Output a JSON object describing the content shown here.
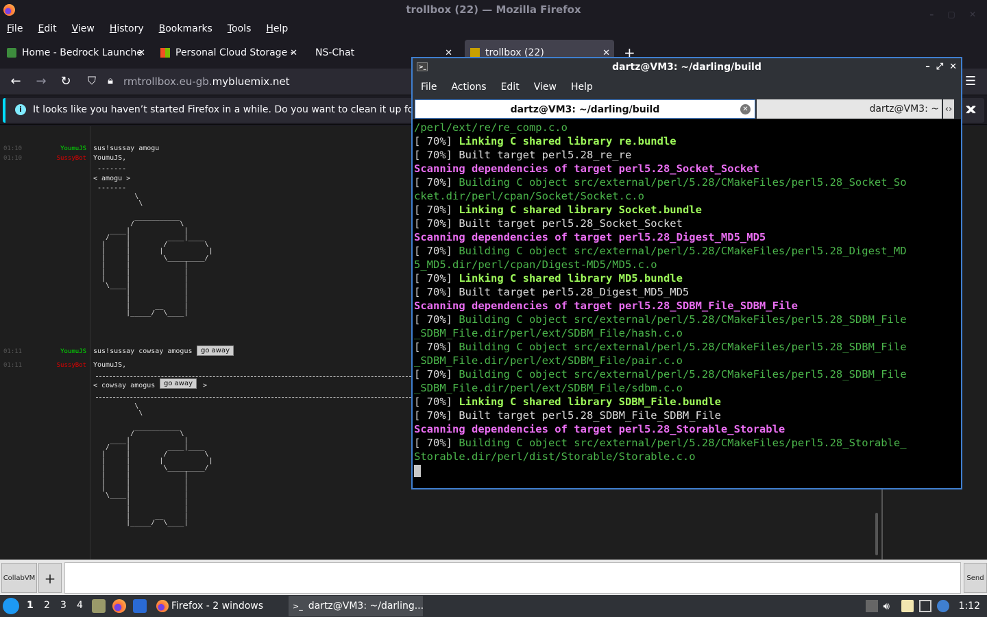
{
  "firefox": {
    "window_title": "trollbox (22) — Mozilla Firefox",
    "menu": [
      "File",
      "Edit",
      "View",
      "History",
      "Bookmarks",
      "Tools",
      "Help"
    ],
    "tabs": [
      {
        "label": "Home - Bedrock Launche",
        "icon": "bedrock-icon"
      },
      {
        "label": "Personal Cloud Storage -",
        "icon": "windows-logo-icon"
      },
      {
        "label": "NS-Chat",
        "icon": ""
      },
      {
        "label": "trollbox (22)",
        "icon": "trollbox-icon"
      }
    ],
    "new_tab_label": "+",
    "url_dim": "rmtrollbox.eu-gb.",
    "url_main": "mybluemix.net",
    "notice": "It looks like you haven’t started Firefox in a while. Do you want to clean it up for a fresh, like-new experience?",
    "notice_icon": "i"
  },
  "trollbox": {
    "messages": [
      {
        "time": "01:10",
        "nick": "YoumuJS",
        "nick_color": "#00e000",
        "text": "sus!sussay amogu"
      },
      {
        "time": "01:10",
        "nick": "SussyBot",
        "nick_color": "#e00000",
        "text": "YoumuJS,"
      },
      {
        "time": "01:11",
        "nick": "YoumuJS",
        "nick_color": "#00e000",
        "text": "sus!sussay cowsay amogus"
      },
      {
        "time": "01:11",
        "nick": "SussyBot",
        "nick_color": "#e00000",
        "text": "YoumuJS,"
      }
    ],
    "bubble1": " -------\n< amogu >\n -------",
    "bubble2_left": "< cowsay amogus",
    "bubble2_right": ">",
    "goaway_label": "go away",
    "ascii_art": "          \\\n           \\\n\n          ___________\n         /           \\\n    ____|             |\n   /    |         ____|____\n  |     |        /         \\\n  |     |       |           |\n  |     |        \\_________/\n  |     |             |\n  |     |             |\n  |     |             |\n   \\____|             |\n        |             |\n        |             |\n        |      __     |\n        |_____/  \\____|",
    "input_room": "CollabVM",
    "add_label": "+",
    "send_label": "Send"
  },
  "terminal": {
    "title": "dartz@VM3: ~/darling/build",
    "menu": [
      "File",
      "Actions",
      "Edit",
      "View",
      "Help"
    ],
    "tab_active": "dartz@VM3: ~/darling/build",
    "tab_other": "dartz@VM3: ~",
    "lines": [
      [
        {
          "c": "green",
          "t": "/perl/ext/re/re_comp.c.o"
        }
      ],
      [
        {
          "c": "plain",
          "t": "[ 70%] "
        },
        {
          "c": "bgreen",
          "t": "Linking C shared library re.bundle"
        }
      ],
      [
        {
          "c": "plain",
          "t": "[ 70%] Built target perl5.28_re_re"
        }
      ],
      [
        {
          "c": "mag",
          "t": "Scanning dependencies of target perl5.28_Socket_Socket"
        }
      ],
      [
        {
          "c": "plain",
          "t": "[ 70%] "
        },
        {
          "c": "green",
          "t": "Building C object src/external/perl/5.28/CMakeFiles/perl5.28_Socket_So"
        }
      ],
      [
        {
          "c": "green",
          "t": "cket.dir/perl/cpan/Socket/Socket.c.o"
        }
      ],
      [
        {
          "c": "plain",
          "t": "[ 70%] "
        },
        {
          "c": "bgreen",
          "t": "Linking C shared library Socket.bundle"
        }
      ],
      [
        {
          "c": "plain",
          "t": "[ 70%] Built target perl5.28_Socket_Socket"
        }
      ],
      [
        {
          "c": "mag",
          "t": "Scanning dependencies of target perl5.28_Digest_MD5_MD5"
        }
      ],
      [
        {
          "c": "plain",
          "t": "[ 70%] "
        },
        {
          "c": "green",
          "t": "Building C object src/external/perl/5.28/CMakeFiles/perl5.28_Digest_MD"
        }
      ],
      [
        {
          "c": "green",
          "t": "5_MD5.dir/perl/cpan/Digest-MD5/MD5.c.o"
        }
      ],
      [
        {
          "c": "plain",
          "t": "[ 70%] "
        },
        {
          "c": "bgreen",
          "t": "Linking C shared library MD5.bundle"
        }
      ],
      [
        {
          "c": "plain",
          "t": "[ 70%] Built target perl5.28_Digest_MD5_MD5"
        }
      ],
      [
        {
          "c": "mag",
          "t": "Scanning dependencies of target perl5.28_SDBM_File_SDBM_File"
        }
      ],
      [
        {
          "c": "plain",
          "t": "[ 70%] "
        },
        {
          "c": "green",
          "t": "Building C object src/external/perl/5.28/CMakeFiles/perl5.28_SDBM_File"
        }
      ],
      [
        {
          "c": "green",
          "t": "_SDBM_File.dir/perl/ext/SDBM_File/hash.c.o"
        }
      ],
      [
        {
          "c": "plain",
          "t": "[ 70%] "
        },
        {
          "c": "green",
          "t": "Building C object src/external/perl/5.28/CMakeFiles/perl5.28_SDBM_File"
        }
      ],
      [
        {
          "c": "green",
          "t": "_SDBM_File.dir/perl/ext/SDBM_File/pair.c.o"
        }
      ],
      [
        {
          "c": "plain",
          "t": "[ 70%] "
        },
        {
          "c": "green",
          "t": "Building C object src/external/perl/5.28/CMakeFiles/perl5.28_SDBM_File"
        }
      ],
      [
        {
          "c": "green",
          "t": "_SDBM_File.dir/perl/ext/SDBM_File/sdbm.c.o"
        }
      ],
      [
        {
          "c": "plain",
          "t": "[ 70%] "
        },
        {
          "c": "bgreen",
          "t": "Linking C shared library SDBM_File.bundle"
        }
      ],
      [
        {
          "c": "plain",
          "t": "[ 70%] Built target perl5.28_SDBM_File_SDBM_File"
        }
      ],
      [
        {
          "c": "mag",
          "t": "Scanning dependencies of target perl5.28_Storable_Storable"
        }
      ],
      [
        {
          "c": "plain",
          "t": "[ 70%] "
        },
        {
          "c": "green",
          "t": "Building C object src/external/perl/5.28/CMakeFiles/perl5.28_Storable_"
        }
      ],
      [
        {
          "c": "green",
          "t": "Storable.dir/perl/dist/Storable/Storable.c.o"
        }
      ]
    ]
  },
  "taskbar": {
    "workspaces": [
      "1",
      "2",
      "3",
      "4"
    ],
    "tasks": [
      {
        "label": "Firefox - 2 windows",
        "icon": "firefox-icon"
      },
      {
        "label": "dartz@VM3: ~/darling...",
        "icon": "terminal-icon"
      }
    ],
    "clock": "1:12",
    "colors": {
      "accent": "#3f7fd0",
      "panel": "#2f3237"
    }
  }
}
